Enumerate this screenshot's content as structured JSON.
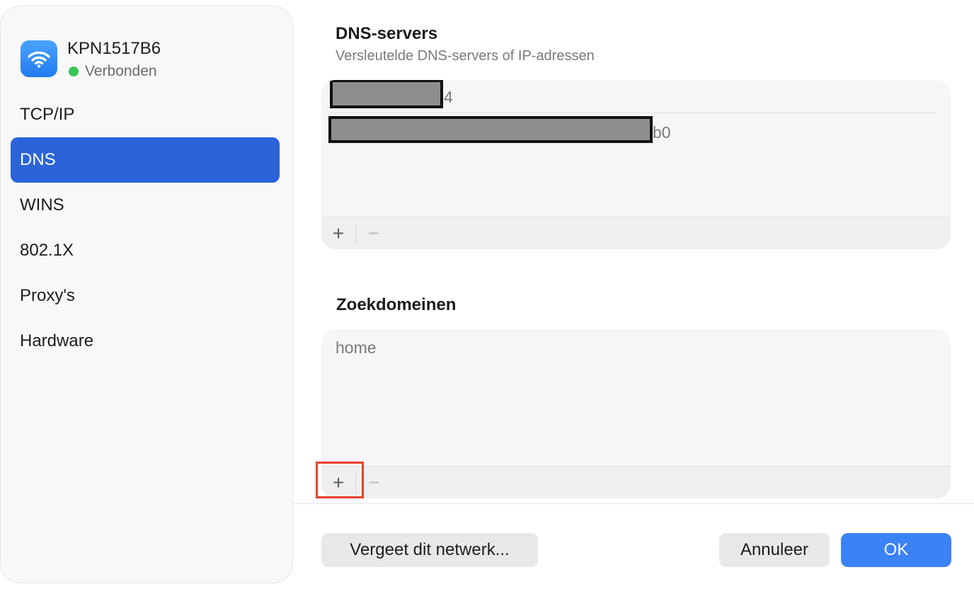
{
  "network": {
    "name": "KPN1517B6",
    "status": "Verbonden",
    "status_color": "#34c759",
    "icon": "wifi-icon"
  },
  "sidebar": {
    "items": [
      {
        "label": "TCP/IP",
        "active": false
      },
      {
        "label": "DNS",
        "active": true
      },
      {
        "label": "WINS",
        "active": false
      },
      {
        "label": "802.1X",
        "active": false
      },
      {
        "label": "Proxy's",
        "active": false
      },
      {
        "label": "Hardware",
        "active": false
      }
    ],
    "active_color": "#2b63d9"
  },
  "dns": {
    "title": "DNS-servers",
    "subtitle": "Versleutelde DNS-servers of IP-adressen",
    "servers": [
      {
        "visible_suffix": "4",
        "redacted": true
      },
      {
        "visible_suffix": "b0",
        "redacted": true
      }
    ],
    "add_label": "+",
    "remove_label": "−"
  },
  "search_domains": {
    "title": "Zoekdomeinen",
    "entries": [
      "home"
    ],
    "add_label": "+",
    "remove_label": "−",
    "highlight_color": "#e8412c"
  },
  "buttons": {
    "forget": "Vergeet dit netwerk...",
    "cancel": "Annuleer",
    "ok": "OK",
    "primary_color": "#3b82f6"
  }
}
